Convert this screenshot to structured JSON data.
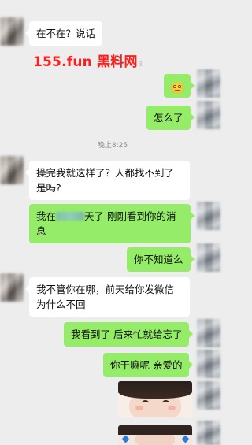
{
  "messages": [
    {
      "side": "in",
      "text": "在不在？说话"
    },
    {
      "side": "out",
      "kind": "emoji",
      "emoji": "smiling-face-emoji"
    },
    {
      "side": "out",
      "text": "怎么了"
    },
    {
      "side": "in",
      "text": "操完我就这样了？人都找不到了是吗?"
    },
    {
      "side": "out",
      "text_before": "我在",
      "redacted": true,
      "text_after": "天了 刚刚看到你的消息"
    },
    {
      "side": "out",
      "text": "你不知道么"
    },
    {
      "side": "in",
      "text": "我不管你在哪，前天给你发微信为什么不回"
    },
    {
      "side": "out",
      "text": "我看到了 后来忙就给忘了"
    },
    {
      "side": "out",
      "text": "你干嘛呢 亲爱的"
    },
    {
      "side": "out",
      "kind": "sticker"
    }
  ],
  "timestamp": "晚上8:25",
  "watermark": {
    "text": "155.fun 黑料网",
    "overlap_text": "3"
  },
  "colors": {
    "background": "#ededed",
    "incoming_bubble": "#ffffff",
    "outgoing_bubble": "#95ec69",
    "watermark": "#ff1e1e"
  }
}
